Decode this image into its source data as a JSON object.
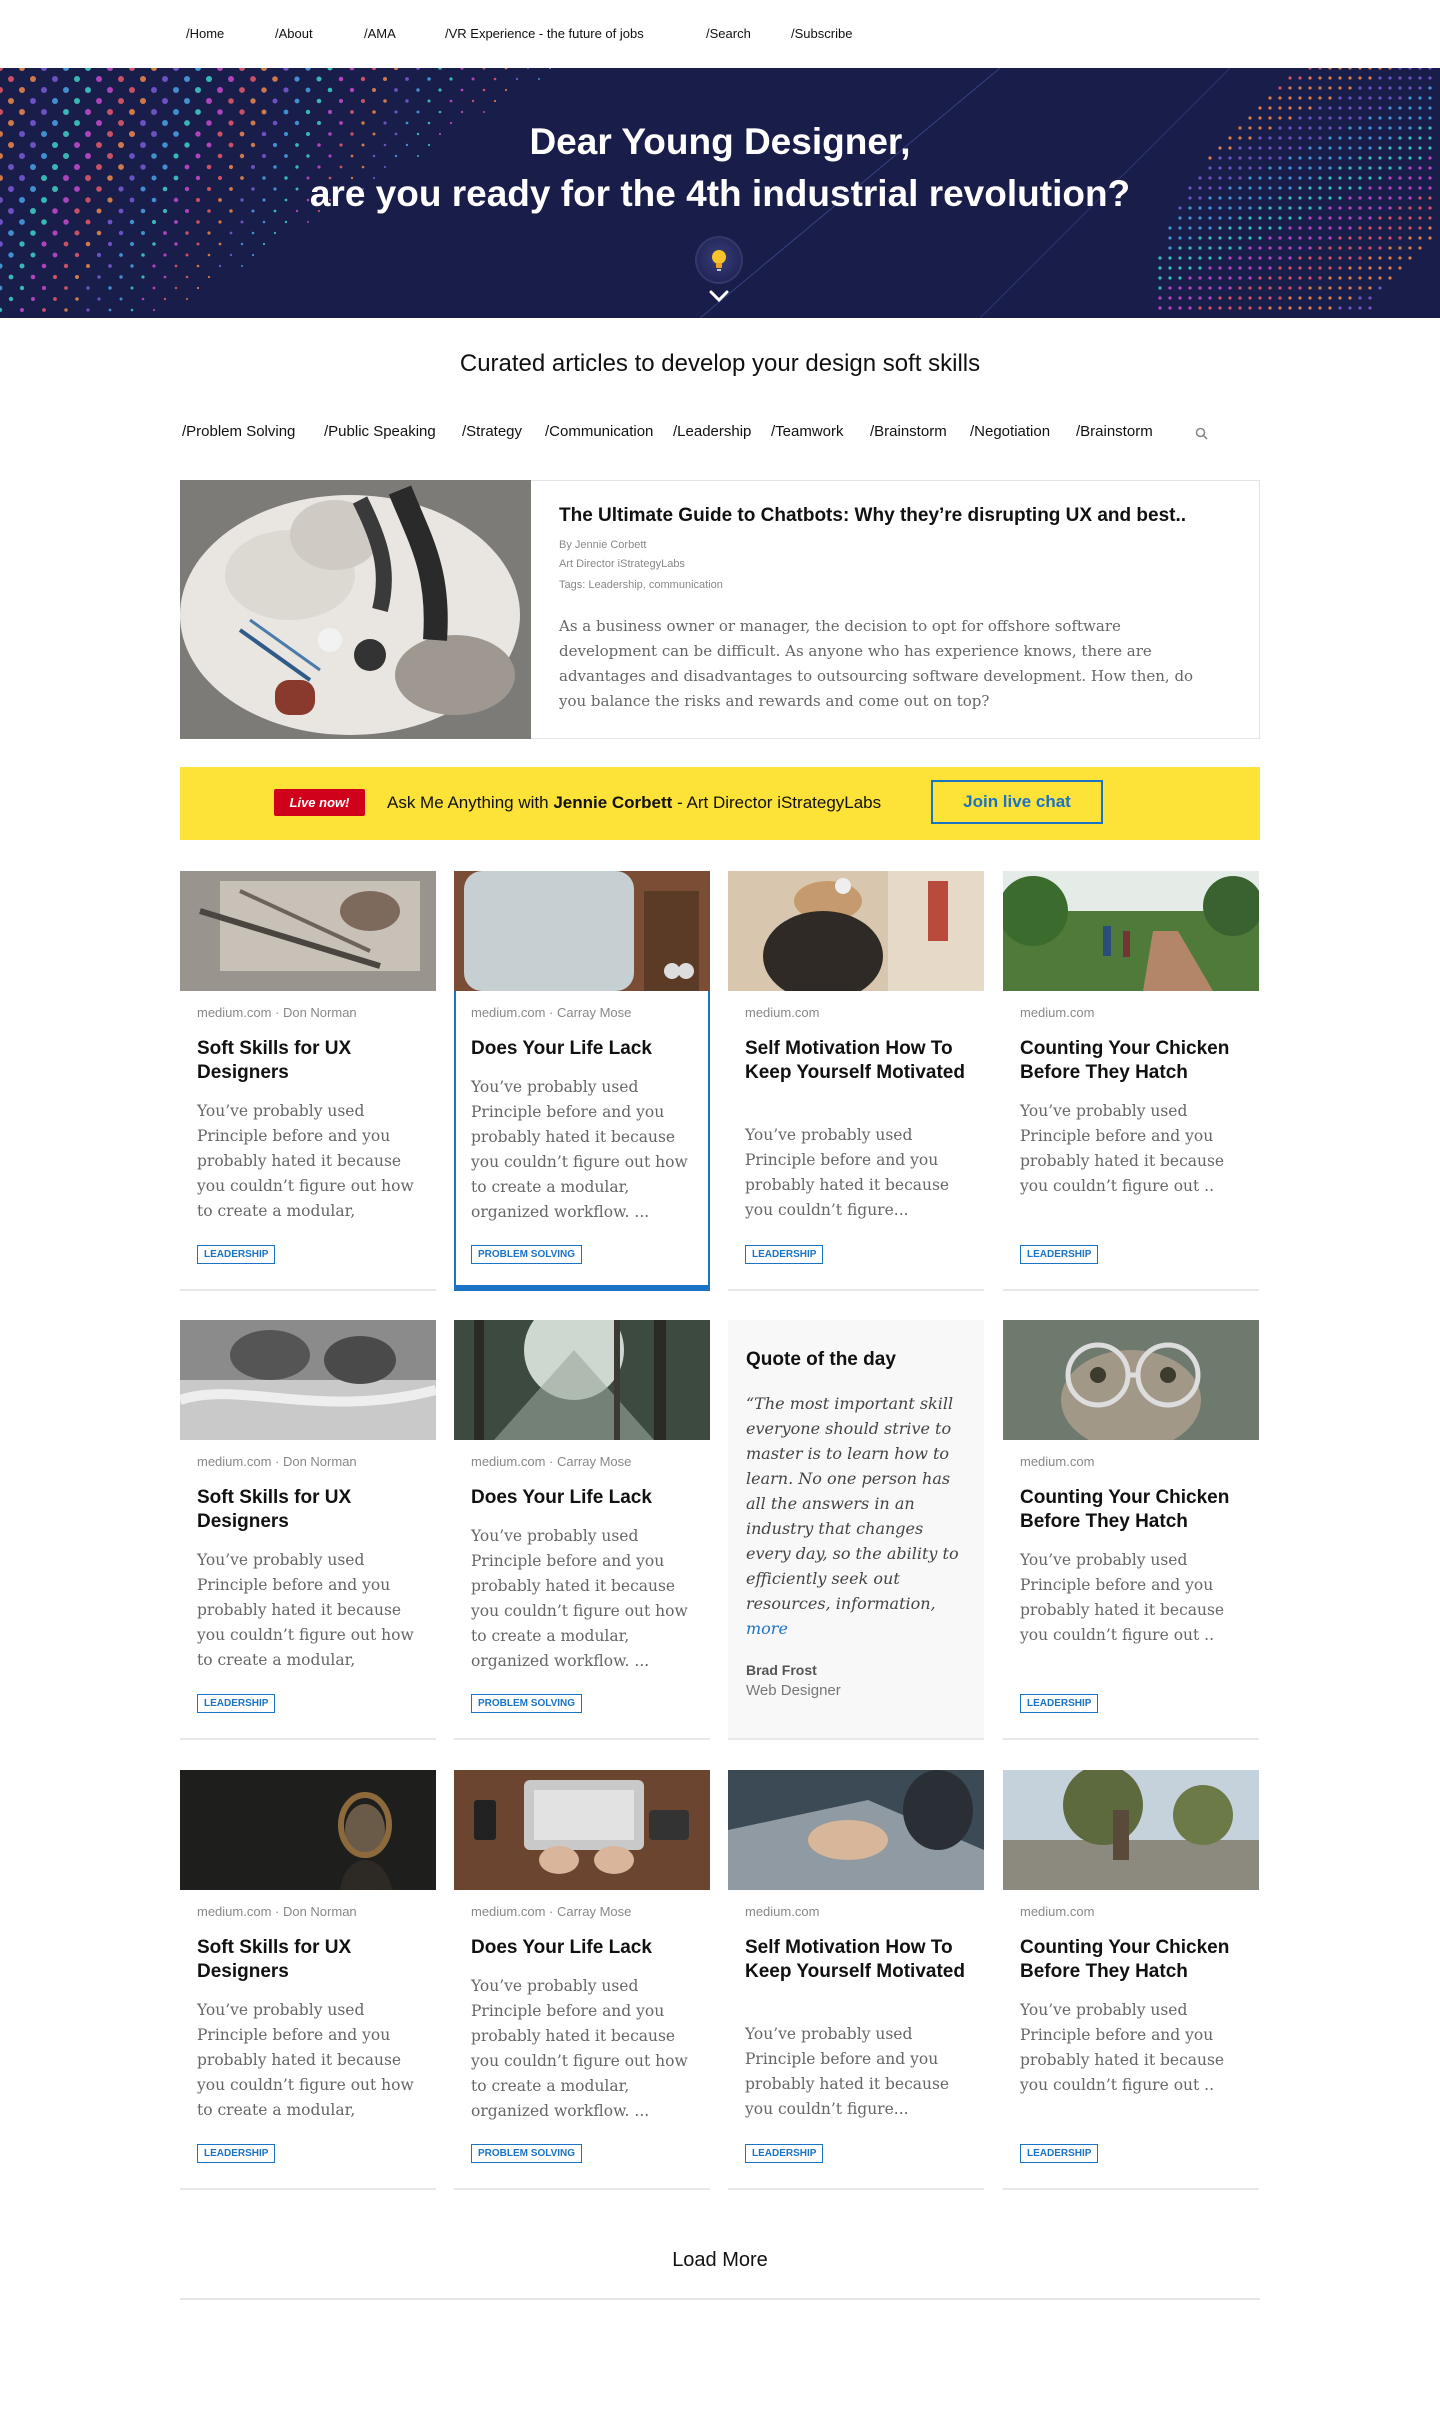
{
  "nav": {
    "items": [
      "/Home",
      "/About",
      "/AMA",
      "/VR Experience - the future of jobs",
      "/Search",
      "/Subscribe"
    ]
  },
  "hero": {
    "line1": "Dear Young Designer,",
    "line2": "are you ready for the 4th industrial revolution?",
    "icons": [
      "lightbulb-icon",
      "chevron-down-icon"
    ]
  },
  "section": {
    "heading": "Curated articles to develop your design soft skills"
  },
  "filters": {
    "tabs": [
      "/Problem Solving",
      "/Public Speaking",
      "/Strategy",
      "/Communication",
      "/Leadership",
      "/Teamwork",
      "/Brainstorm",
      "/Negotiation",
      "/Brainstorm"
    ],
    "search_icon": "search-icon"
  },
  "featured": {
    "title": "The Ultimate Guide to Chatbots: Why they’re disrupting UX and best..",
    "author": "By Jennie Corbett",
    "role": "Art Director iStrategyLabs",
    "tags": "Tags: Leadership, communication",
    "excerpt": "As a business owner or manager, the decision to opt for offshore software development can be difficult. As anyone who has experience knows, there are advantages and disadvantages to outsourcing software development. How then, do you balance the risks and rewards and come out on top?"
  },
  "live": {
    "badge": "Live now!",
    "prefix": "Ask Me Anything with ",
    "name": "Jennie Corbett",
    "suffix": " - Art Director iStrategyLabs",
    "button": "Join live chat"
  },
  "cards": [
    {
      "source": "medium.com · Don Norman",
      "title": "Soft Skills for UX Designers",
      "excerpt": "You’ve probably used Principle before and you probably hated it because you couldn’t figure out how to create a modular,",
      "tag": "LEADERSHIP"
    },
    {
      "source": "medium.com · Carray Mose",
      "title": "Does Your Life Lack",
      "excerpt": "You’ve probably used Principle before and you probably hated it because you couldn’t figure out how to create a modular, organized workflow. ...",
      "tag": "PROBLEM SOLVING"
    },
    {
      "source": "medium.com",
      "title": "Self Motivation How To Keep Yourself Motivated",
      "excerpt": "You’ve probably used Principle before and you probably hated it because you couldn’t figure...",
      "tag": "LEADERSHIP"
    },
    {
      "source": "medium.com",
      "title": "Counting Your Chicken Before They Hatch",
      "excerpt": "You’ve probably used Principle before and you probably hated it because you couldn’t figure out ..",
      "tag": "LEADERSHIP"
    },
    {
      "source": "medium.com · Don Norman",
      "title": "Soft Skills for UX Designers",
      "excerpt": "You’ve probably used Principle before and you probably hated it because you couldn’t figure out how to create a modular,",
      "tag": "LEADERSHIP"
    },
    {
      "source": "medium.com · Carray Mose",
      "title": "Does Your Life Lack",
      "excerpt": "You’ve probably used Principle before and you probably hated it because you couldn’t figure out how to create a modular, organized workflow. ...",
      "tag": "PROBLEM SOLVING"
    },
    {
      "source": "medium.com",
      "title": "Counting Your Chicken Before They Hatch",
      "excerpt": "You’ve probably used Principle before and you probably hated it because you couldn’t figure out ..",
      "tag": "LEADERSHIP"
    },
    {
      "source": "medium.com · Don Norman",
      "title": "Soft Skills for UX Designers",
      "excerpt": "You’ve probably used Principle before and you probably hated it because you couldn’t figure out how to create a modular,",
      "tag": "LEADERSHIP"
    },
    {
      "source": "medium.com · Carray Mose",
      "title": "Does Your Life Lack",
      "excerpt": "You’ve probably used Principle before and you probably hated it because you couldn’t figure out how to create a modular, organized workflow. ...",
      "tag": "PROBLEM SOLVING"
    },
    {
      "source": "medium.com",
      "title": "Self Motivation How To Keep Yourself Motivated",
      "excerpt": "You’ve probably used Principle before and you probably hated it because you couldn’t figure...",
      "tag": "LEADERSHIP"
    },
    {
      "source": "medium.com",
      "title": "Counting Your Chicken Before They Hatch",
      "excerpt": "You’ve probably used Principle before and you probably hated it because you couldn’t figure out ..",
      "tag": "LEADERSHIP"
    }
  ],
  "quote": {
    "heading": "Quote of the day",
    "text": "“The most important skill everyone should strive to master is to learn how to learn. No one person has all the answers in an industry that changes every day, so the ability to efficiently seek out resources, information,",
    "more": "more",
    "author": "Brad Frost",
    "role": "Web Designer"
  },
  "load_more": "Load More",
  "colors": {
    "accent": "#1b73c6",
    "banner": "#fde238",
    "live_badge": "#d0021b",
    "hero_bg": "#191d49"
  }
}
